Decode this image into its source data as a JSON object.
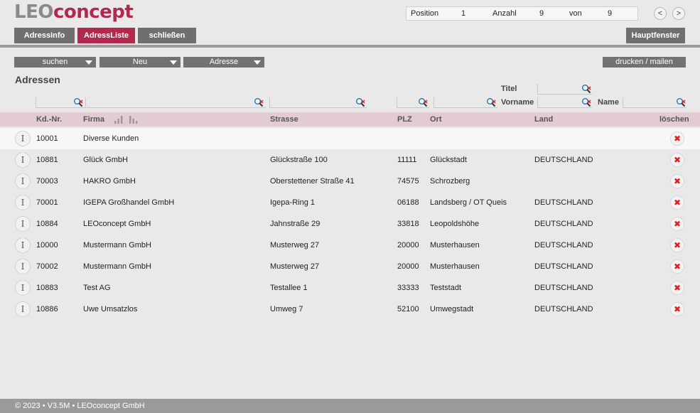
{
  "logo": {
    "part1": "LEO",
    "part2": "concept"
  },
  "position_box": {
    "position_label": "Position",
    "position_value": "1",
    "count_label": "Anzahl",
    "count_value": "9",
    "of_label": "von",
    "of_value": "9"
  },
  "nav": {
    "prev": "<",
    "next": ">"
  },
  "tabs": [
    {
      "label": "AdressInfo"
    },
    {
      "label": "AdressListe"
    },
    {
      "label": "schließen"
    }
  ],
  "main_window_button": "Hauptfenster",
  "toolbar": {
    "search": "suchen",
    "new": "Neu",
    "address": "Adresse",
    "print": "drucken / mailen"
  },
  "heading": "Adressen",
  "filters": {
    "title_label": "Titel",
    "firstname_label": "Vorname",
    "name_label": "Name"
  },
  "columns": {
    "kdnr": "Kd.-Nr.",
    "firma": "Firma",
    "strasse": "Strasse",
    "plz": "PLZ",
    "ort": "Ort",
    "land": "Land",
    "loeschen": "löschen"
  },
  "rows": [
    {
      "kdnr": "10001",
      "firma": "Diverse Kunden",
      "strasse": "",
      "plz": "",
      "ort": "",
      "land": ""
    },
    {
      "kdnr": "10881",
      "firma": "Glück GmbH",
      "strasse": "Glückstraße 100",
      "plz": "11111",
      "ort": "Glückstadt",
      "land": "DEUTSCHLAND"
    },
    {
      "kdnr": "70003",
      "firma": "HAKRO GmbH",
      "strasse": "Oberstettener Straße 41",
      "plz": "74575",
      "ort": "Schrozberg",
      "land": ""
    },
    {
      "kdnr": "70001",
      "firma": "IGEPA Großhandel GmbH",
      "strasse": "Igepa-Ring 1",
      "plz": "06188",
      "ort": "Landsberg / OT Queis",
      "land": "DEUTSCHLAND"
    },
    {
      "kdnr": "10884",
      "firma": "LEOconcept GmbH",
      "strasse": "Jahnstraße 29",
      "plz": "33818",
      "ort": "Leopoldshöhe",
      "land": "DEUTSCHLAND"
    },
    {
      "kdnr": "10000",
      "firma": "Mustermann GmbH",
      "strasse": "Musterweg 27",
      "plz": "20000",
      "ort": "Musterhausen",
      "land": "DEUTSCHLAND"
    },
    {
      "kdnr": "70002",
      "firma": "Mustermann GmbH",
      "strasse": "Musterweg 27",
      "plz": "20000",
      "ort": "Musterhausen",
      "land": "DEUTSCHLAND"
    },
    {
      "kdnr": "10883",
      "firma": "Test AG",
      "strasse": "Testallee 1",
      "plz": "33333",
      "ort": "Teststadt",
      "land": "DEUTSCHLAND"
    },
    {
      "kdnr": "10886",
      "firma": "Uwe Umsatzlos",
      "strasse": "Umweg 7",
      "plz": "52100",
      "ort": "Umwegstadt",
      "land": "DEUTSCHLAND"
    }
  ],
  "row_buttons": {
    "info": "I",
    "delete": "✖"
  },
  "footer": "© 2023 • V3.5M • LEOconcept GmbH",
  "colors": {
    "accent": "#b3284d",
    "tab_gray": "#6f6f6f",
    "header_row": "#e2cbd1",
    "delete_red": "#e02020"
  }
}
